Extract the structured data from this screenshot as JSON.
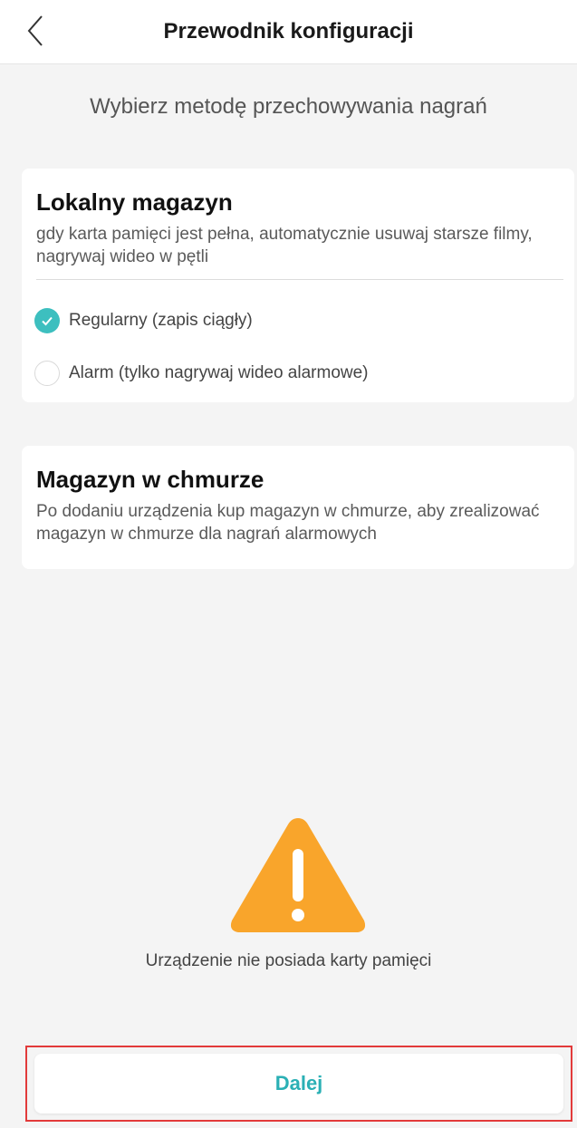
{
  "header": {
    "title": "Przewodnik konfiguracji",
    "back_icon": "chevron-left-icon"
  },
  "subtitle": "Wybierz metodę przechowywania nagrań",
  "local_storage": {
    "title": "Lokalny magazyn",
    "description": "gdy karta pamięci jest pełna, automatycznie usuwaj starsze filmy, nagrywaj wideo w pętli",
    "options": [
      {
        "label": "Regularny (zapis ciągły)",
        "selected": true
      },
      {
        "label": "Alarm (tylko nagrywaj wideo alarmowe)",
        "selected": false
      }
    ]
  },
  "cloud_storage": {
    "title": "Magazyn w chmurze",
    "description": "Po dodaniu urządzenia kup magazyn w chmurze, aby zrealizować magazyn w chmurze dla nagrań alarmowych"
  },
  "warning": {
    "icon": "warning-icon",
    "text": "Urządzenie nie posiada karty pamięci"
  },
  "footer": {
    "next_label": "Dalej"
  },
  "colors": {
    "accent": "#3dbfbf",
    "button_text": "#2bb0b5",
    "warning": "#f9a52b",
    "highlight_frame": "#e23a3a"
  }
}
